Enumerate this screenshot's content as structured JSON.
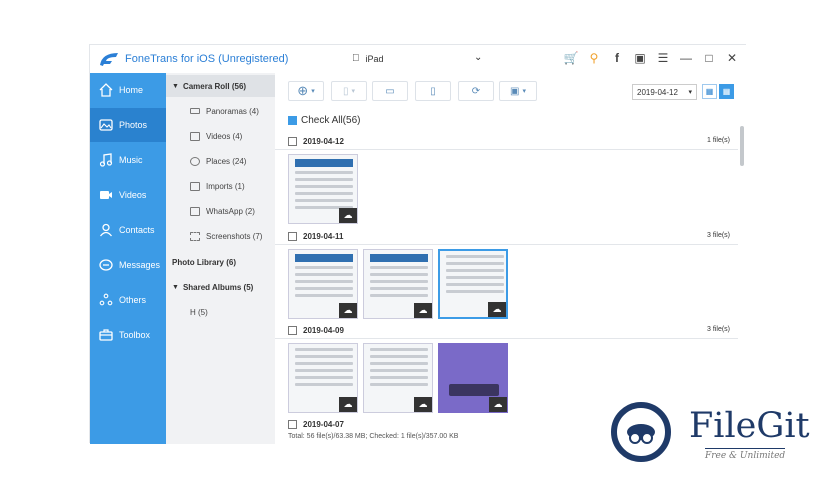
{
  "titlebar": {
    "app_title": "FoneTrans for iOS (Unregistered)",
    "device_name": "iPad",
    "icons": [
      "cart-icon",
      "key-icon",
      "facebook-icon",
      "chat-icon",
      "menu-icon",
      "minimize-icon",
      "maximize-icon",
      "close-icon"
    ]
  },
  "sidebar": {
    "items": [
      {
        "label": "Home",
        "icon": "home-icon"
      },
      {
        "label": "Photos",
        "icon": "photos-icon",
        "active": true
      },
      {
        "label": "Music",
        "icon": "music-icon"
      },
      {
        "label": "Videos",
        "icon": "videos-icon"
      },
      {
        "label": "Contacts",
        "icon": "contacts-icon"
      },
      {
        "label": "Messages",
        "icon": "messages-icon"
      },
      {
        "label": "Others",
        "icon": "others-icon"
      },
      {
        "label": "Toolbox",
        "icon": "toolbox-icon"
      }
    ]
  },
  "tree": {
    "camera_roll": "Camera Roll (56)",
    "children": [
      {
        "label": "Panoramas (4)"
      },
      {
        "label": "Videos (4)"
      },
      {
        "label": "Places (24)"
      },
      {
        "label": "Imports (1)"
      },
      {
        "label": "WhatsApp (2)"
      },
      {
        "label": "Screenshots (7)"
      }
    ],
    "photo_library": "Photo Library (6)",
    "shared_albums": "Shared Albums (5)",
    "shared_children": [
      {
        "label": "H (5)"
      }
    ]
  },
  "toolbar": {
    "date_value": "2019-04-12",
    "buttons": [
      "add-button",
      "export-button",
      "export-pc-button",
      "delete-button",
      "refresh-button",
      "toolbox-button"
    ]
  },
  "main": {
    "check_all": "Check All(56)",
    "days": [
      {
        "date": "2019-04-12",
        "count": "1 file(s)"
      },
      {
        "date": "2019-04-11",
        "count": "3 file(s)"
      },
      {
        "date": "2019-04-09",
        "count": "3 file(s)"
      },
      {
        "date": "2019-04-07",
        "count": ""
      }
    ]
  },
  "status": {
    "text": "Total: 56 file(s)/63.38 MB; Checked: 1 file(s)/357.00 KB"
  },
  "watermark": {
    "name": "FileGit",
    "tagline": "Free & Unlimited"
  },
  "colors": {
    "sidebar": "#3c9be6",
    "sidebar_active": "#2a82cf",
    "brand_dark": "#1f3a68"
  }
}
